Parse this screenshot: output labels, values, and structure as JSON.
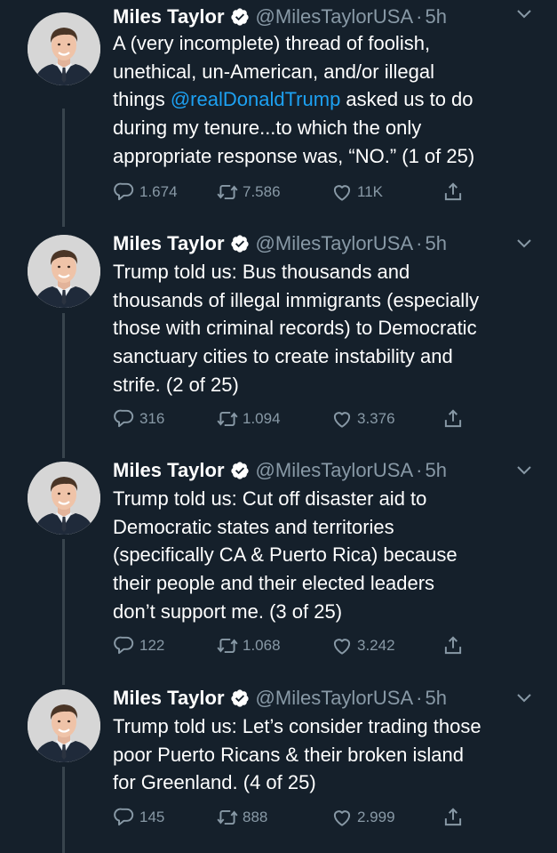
{
  "tweets": [
    {
      "name": "Miles Taylor",
      "handle": "@MilesTaylorUSA",
      "dot": "·",
      "time": "5h",
      "lines": [
        "A (very incomplete) thread of foolish,",
        "unethical, un-American, and/or illegal",
        "things ",
        "during my tenure...to which the only",
        "appropriate response was, “NO.” (1 of 25)"
      ],
      "mention": "@realDonaldTrump",
      "mention_suffix": " asked us to do",
      "replies": "1.674",
      "retweets": "7.586",
      "likes": "11K"
    },
    {
      "name": "Miles Taylor",
      "handle": "@MilesTaylorUSA",
      "dot": "·",
      "time": "5h",
      "lines": [
        "Trump told us: Bus thousands and",
        "thousands of illegal immigrants (especially",
        "those with criminal records) to Democratic",
        "sanctuary cities to create instability and",
        "strife. (2 of 25)"
      ],
      "replies": "316",
      "retweets": "1.094",
      "likes": "3.376"
    },
    {
      "name": "Miles Taylor",
      "handle": "@MilesTaylorUSA",
      "dot": "·",
      "time": "5h",
      "lines": [
        "Trump told us: Cut off disaster aid to",
        "Democratic states and territories",
        "(specifically CA & Puerto Rica) because",
        "their people and their elected leaders",
        "don’t support me. (3 of 25)"
      ],
      "replies": "122",
      "retweets": "1.068",
      "likes": "3.242"
    },
    {
      "name": "Miles Taylor",
      "handle": "@MilesTaylorUSA",
      "dot": "·",
      "time": "5h",
      "lines": [
        "Trump told us: Let’s consider trading those",
        "poor Puerto Ricans & their broken island",
        "for Greenland. (4 of 25)"
      ],
      "replies": "145",
      "retweets": "888",
      "likes": "2.999"
    }
  ],
  "colors": {
    "background": "#15202b",
    "text": "#ffffff",
    "secondary": "#8899a6",
    "link": "#1da1f2",
    "thread_line": "#38444d"
  },
  "icons": {
    "verified": "verified-badge-icon",
    "caret": "chevron-down-icon",
    "reply": "reply-icon",
    "retweet": "retweet-icon",
    "like": "heart-icon",
    "share": "share-icon"
  }
}
